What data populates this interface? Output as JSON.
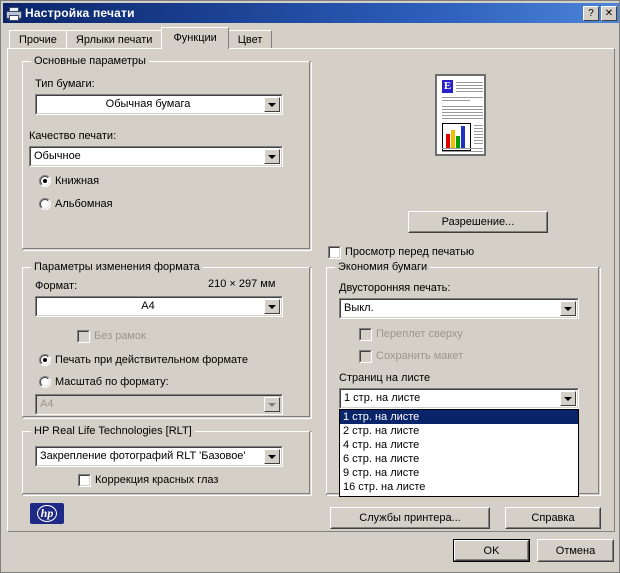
{
  "window": {
    "title": "Настройка печати",
    "icon": "printer-icon",
    "help_button": "?",
    "close_button": "✕",
    "titlebar_color": "#0a246a",
    "face_color": "#d4d0c8"
  },
  "tabs": [
    {
      "label": "Прочие",
      "active": false
    },
    {
      "label": "Ярлыки печати",
      "active": false
    },
    {
      "label": "Функции",
      "active": true
    },
    {
      "label": "Цвет",
      "active": false
    }
  ],
  "main_params": {
    "group_title": "Основные параметры",
    "paper_type_label": "Тип бумаги:",
    "paper_type_value": "Обычная бумага",
    "print_quality_label": "Качество печати:",
    "print_quality_value": "Обычное",
    "orientation": [
      {
        "label": "Книжная",
        "checked": true
      },
      {
        "label": "Альбомная",
        "checked": false
      }
    ]
  },
  "format_params": {
    "group_title": "Параметры изменения формата",
    "format_label": "Формат:",
    "dimensions": "210 × 297 мм",
    "format_value": "A4",
    "borderless_label": "Без рамок",
    "borderless_checked": false,
    "borderless_disabled": true,
    "scale_options": [
      {
        "label": "Печать при действительном формате",
        "checked": true
      },
      {
        "label": "Масштаб по формату:",
        "checked": false
      }
    ],
    "scale_target_value": "A4",
    "scale_target_disabled": true
  },
  "rlt": {
    "group_title": "HP Real Life Technologies [RLT]",
    "value": "Закрепление фотографий RLT 'Базовое'",
    "redeye_label": "Коррекция красных глаз",
    "redeye_checked": false
  },
  "preview": {
    "name": "print-preview-thumbnail",
    "dropcap": "E",
    "resolution_button": "Разрешение...",
    "print_preview_checkbox": "Просмотр перед печатью",
    "print_preview_checked": false
  },
  "paper_saving": {
    "group_title": "Экономия бумаги",
    "duplex_label": "Двусторонняя печать:",
    "duplex_value": "Выкл.",
    "binding_top_label": "Переплет сверху",
    "binding_top_checked": false,
    "binding_top_disabled": true,
    "keep_layout_label": "Сохранить макет",
    "keep_layout_checked": false,
    "keep_layout_disabled": true,
    "pages_per_sheet_label": "Страниц на листе",
    "pages_per_sheet_value": "1 стр. на листе",
    "dropdown_open": true,
    "pages_per_sheet_options": [
      {
        "label": "1 стр. на листе",
        "selected": true
      },
      {
        "label": "2 стр. на листе",
        "selected": false
      },
      {
        "label": "4 стр. на листе",
        "selected": false
      },
      {
        "label": "6 стр. на листе",
        "selected": false
      },
      {
        "label": "9 стр. на листе",
        "selected": false
      },
      {
        "label": "16 стр. на листе",
        "selected": false
      }
    ]
  },
  "footer": {
    "printer_services": "Службы принтера...",
    "help": "Справка",
    "ok": "OK",
    "cancel": "Отмена"
  },
  "branding": {
    "hp_logo_text": "hp",
    "hp_logo_color": "#1f2a86"
  }
}
